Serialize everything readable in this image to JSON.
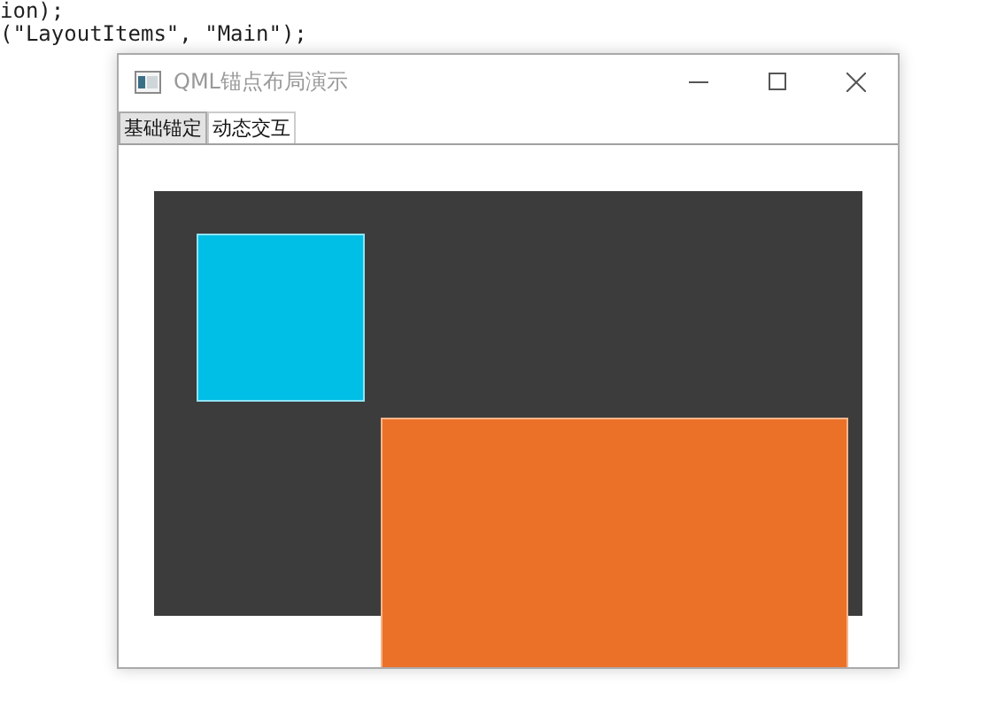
{
  "code_lines": [
    "ion);",
    "(\"LayoutItems\", \"Main\");"
  ],
  "window": {
    "title": "QML锚点布局演示"
  },
  "tabs": [
    {
      "label": "基础锚定",
      "selected": true
    },
    {
      "label": "动态交互",
      "selected": false
    }
  ]
}
